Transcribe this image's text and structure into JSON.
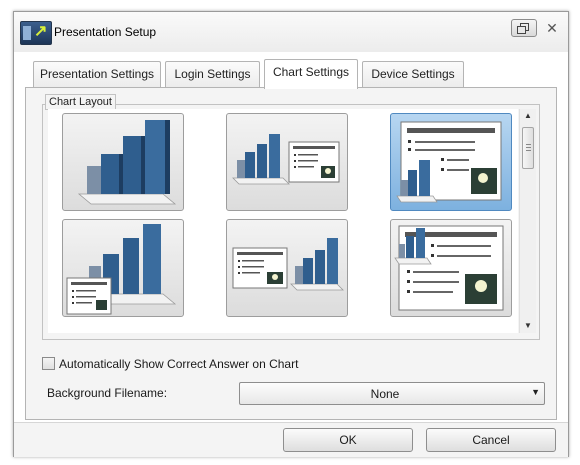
{
  "window": {
    "title": "Presentation Setup",
    "close_glyph": "✕"
  },
  "icons": {
    "app": "presentation-app-icon",
    "restore": "restore-icon",
    "close": "close-icon"
  },
  "tabs": [
    {
      "label": "Presentation Settings",
      "active": false
    },
    {
      "label": "Login Settings",
      "active": false
    },
    {
      "label": "Chart Settings",
      "active": true
    },
    {
      "label": "Device Settings",
      "active": false
    }
  ],
  "chart_layout": {
    "label": "Chart Layout",
    "options": [
      {
        "name": "chart-only",
        "selected": false
      },
      {
        "name": "chart-with-slide-right",
        "selected": false
      },
      {
        "name": "slide-with-chart-overlay",
        "selected": true
      },
      {
        "name": "chart-with-slide-inset-left",
        "selected": false
      },
      {
        "name": "slide-left-chart-right",
        "selected": false
      },
      {
        "name": "slide-with-chart-top-left",
        "selected": false
      }
    ]
  },
  "options": {
    "auto_show_correct_label": "Automatically Show Correct Answer on Chart",
    "auto_show_correct_checked": false,
    "background_filename_label": "Background Filename:",
    "background_filename_value": "None"
  },
  "buttons": {
    "ok": "OK",
    "cancel": "Cancel"
  },
  "colors": {
    "selected_bg": "#8fc0ea",
    "bar_blue": "#2f5e8e"
  }
}
